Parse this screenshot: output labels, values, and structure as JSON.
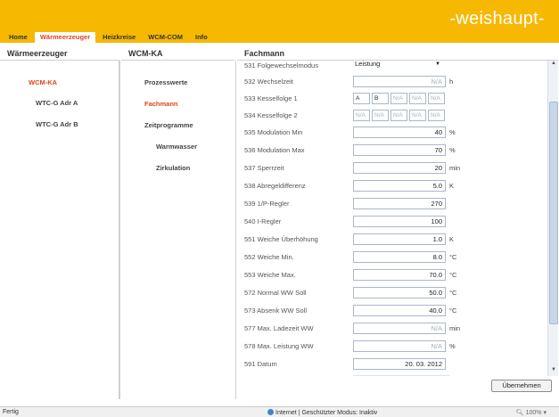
{
  "brand": {
    "logo": "-weishaupt-"
  },
  "nav": {
    "tabs": [
      {
        "label": "Home",
        "active": false
      },
      {
        "label": "Wärmeerzeuger",
        "active": true
      },
      {
        "label": "Heizkreise",
        "active": false
      },
      {
        "label": "WCM-COM",
        "active": false
      },
      {
        "label": "Info",
        "active": false
      }
    ]
  },
  "columns": {
    "col1_title": "Wärmeerzeuger",
    "col2_title": "WCM-KA",
    "col3_title": "Fachmann"
  },
  "tree1": [
    {
      "label": "WCM-KA",
      "selected": true
    },
    {
      "label": "WTC-G Adr A",
      "selected": false
    },
    {
      "label": "WTC-G Adr B",
      "selected": false
    }
  ],
  "tree2": [
    {
      "label": "Prozesswerte",
      "selected": false
    },
    {
      "label": "Fachmann",
      "selected": true
    },
    {
      "label": "Zeitprogramme",
      "selected": false
    },
    {
      "label": "Warmwasser",
      "selected": false
    },
    {
      "label": "Zirkulation",
      "selected": false
    }
  ],
  "params": [
    {
      "label": "531 Folgewechselmodus",
      "select": "Leistung"
    },
    {
      "label": "532 Wechselzeit",
      "value": "N/A",
      "unit": "h",
      "na": true
    },
    {
      "label": "533 Kesselfolge 1",
      "boxes": [
        "A",
        "B",
        "N/A",
        "N/A",
        "N/A"
      ]
    },
    {
      "label": "534 Kesselfolge 2",
      "boxes": [
        "N/A",
        "N/A",
        "N/A",
        "N/A",
        "N/A"
      ]
    },
    {
      "label": "535 Modulation Min",
      "value": "40",
      "unit": "%"
    },
    {
      "label": "536 Modulation Max",
      "value": "70",
      "unit": "%"
    },
    {
      "label": "537 Sperrzeit",
      "value": "20",
      "unit": "min"
    },
    {
      "label": "538 Abregeldifferenz",
      "value": "5.0",
      "unit": "K"
    },
    {
      "label": "539 1/P-Regler",
      "value": "270",
      "unit": ""
    },
    {
      "label": "540 I-Regler",
      "value": "100",
      "unit": ""
    },
    {
      "label": "551 Weiche Überhöhung",
      "value": "1.0",
      "unit": "K"
    },
    {
      "label": "552 Weiche Min.",
      "value": "8.0",
      "unit": "°C"
    },
    {
      "label": "553 Weiche Max.",
      "value": "70.0",
      "unit": "°C"
    },
    {
      "label": "572 Normal WW Soll",
      "value": "50.0",
      "unit": "°C"
    },
    {
      "label": "573 Absenk WW Soll",
      "value": "40.0",
      "unit": "°C"
    },
    {
      "label": "577 Max. Ladezeit WW",
      "value": "N/A",
      "unit": "min",
      "na": true
    },
    {
      "label": "578 Max. Leistung WW",
      "value": "N/A",
      "unit": "%",
      "na": true
    },
    {
      "label": "591 Datum",
      "value": "20. 03. 2012",
      "unit": ""
    }
  ],
  "buttons": {
    "apply": "Übernehmen"
  },
  "status": {
    "left": "Fertig",
    "mid": "Internet | Geschützter Modus: Inaktiv",
    "zoom": "100%"
  },
  "icons": {
    "scroll_up": "scroll-up-icon",
    "scroll_down": "scroll-down-icon",
    "globe": "globe-icon"
  }
}
